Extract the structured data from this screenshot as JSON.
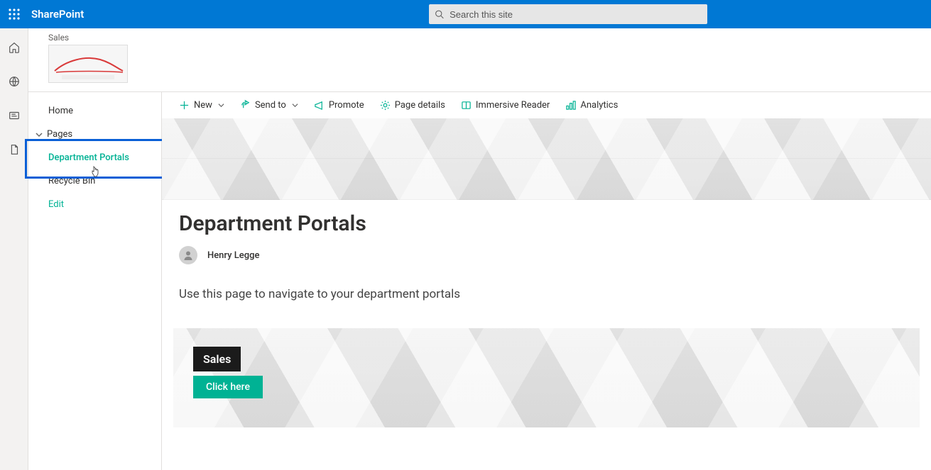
{
  "suite": {
    "app_name": "SharePoint",
    "search_placeholder": "Search this site"
  },
  "apprail": {
    "item0": "home-icon",
    "item1": "globe-icon",
    "item2": "news-icon",
    "item3": "file-icon"
  },
  "site": {
    "breadcrumb": "Sales"
  },
  "nav": {
    "home": "Home",
    "pages": "Pages",
    "department_portals": "Department Portals",
    "recycle_bin": "Recycle Bin",
    "edit": "Edit"
  },
  "cmdbar": {
    "new": "New",
    "send_to": "Send to",
    "promote": "Promote",
    "page_details": "Page details",
    "immersive_reader": "Immersive Reader",
    "analytics": "Analytics"
  },
  "page": {
    "title": "Department Portals",
    "author": "Henry Legge",
    "intro": "Use this page to navigate to your department portals"
  },
  "linkcard": {
    "title": "Sales",
    "button": "Click here"
  }
}
